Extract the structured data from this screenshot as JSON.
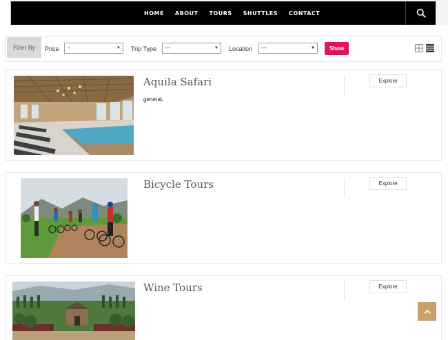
{
  "nav": {
    "links": [
      "HOME",
      "ABOUT",
      "TOURS",
      "SHUTTLES",
      "CONTACT"
    ],
    "search_icon": "search-icon"
  },
  "filter": {
    "filter_by_label": "Filter By",
    "price_label": "Price",
    "price_value": "--",
    "trip_type_label": "Trip Type",
    "trip_type_value": "—",
    "location_label": "Location",
    "location_value": "—",
    "show_label": "Show",
    "show_color": "#e0145e"
  },
  "tours": [
    {
      "title": "Aquila Safari",
      "description": "generaL",
      "explore_label": "Explore"
    },
    {
      "title": "Bicycle Tours",
      "description": "",
      "explore_label": "Explore"
    },
    {
      "title": "Wine Tours",
      "description": "",
      "explore_label": "Explore"
    }
  ],
  "colors": {
    "nav_bg": "#000000",
    "accent": "#e0145e",
    "scroll_top_bg": "#c9a06c"
  }
}
